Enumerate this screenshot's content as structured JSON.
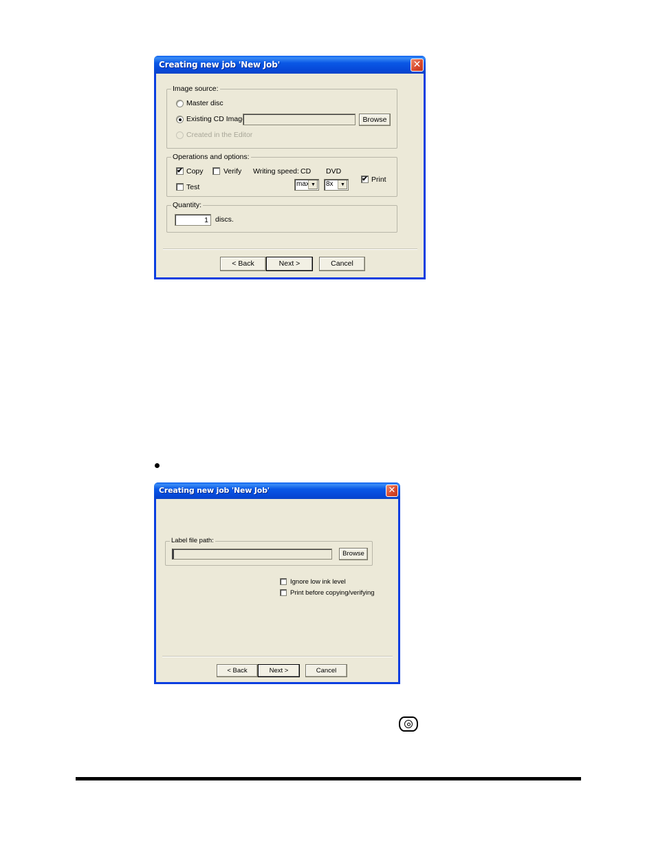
{
  "dialog1": {
    "title": "Creating new job 'New Job'",
    "close_glyph": "✕",
    "image_source": {
      "legend": "Image source:",
      "options": [
        {
          "label": "Master disc",
          "checked": false,
          "disabled": false
        },
        {
          "label": "Existing CD Image:",
          "checked": true,
          "disabled": false
        },
        {
          "label": "Created in the Editor",
          "checked": false,
          "disabled": true
        }
      ],
      "image_path_value": "",
      "browse_label": "Browse"
    },
    "operations": {
      "legend": "Operations and options:",
      "copy": {
        "label": "Copy",
        "checked": true
      },
      "verify": {
        "label": "Verify",
        "checked": false
      },
      "test": {
        "label": "Test",
        "checked": false
      },
      "writing_speed_label": "Writing speed:",
      "cd_label": "CD",
      "dvd_label": "DVD",
      "cd_speed_value": "max",
      "dvd_speed_value": "8x",
      "print": {
        "label": "Print",
        "checked": true
      },
      "check_glyph": "✔",
      "arrow_glyph": "▼"
    },
    "quantity": {
      "legend": "Quantity:",
      "value": "1",
      "unit": "discs."
    },
    "buttons": {
      "back": "< Back",
      "next": "Next >",
      "cancel": "Cancel"
    }
  },
  "dialog2": {
    "title": "Creating new job 'New Job'",
    "close_glyph": "✕",
    "label_file": {
      "legend": "Label file path:",
      "value": "",
      "browse_label": "Browse"
    },
    "ignore_low_ink": {
      "label": "Ignore low ink level",
      "checked": false
    },
    "print_before": {
      "label": "Print before copying/verifying",
      "checked": false
    },
    "buttons": {
      "back": "< Back",
      "next": "Next >",
      "cancel": "Cancel"
    }
  },
  "page": {
    "bullet_icon": "bullet-icon",
    "disc_button_icon": "disc-button-icon"
  }
}
